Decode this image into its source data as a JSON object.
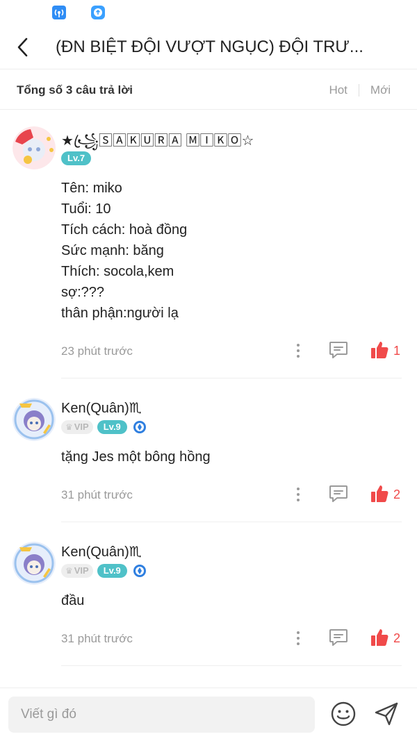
{
  "header": {
    "title": "(ĐN BIỆT ĐỘI VƯỢT NGỤC) ĐỘI TRƯ..."
  },
  "summary": {
    "count_label": "Tổng số 3 câu trả lời",
    "sort_hot": "Hot",
    "sort_new": "Mới"
  },
  "comments": [
    {
      "author": "★꧁ꦿ🅂🄰🄺🅄🅁🄰 🄼🄸🄺🄾☆",
      "level": "Lv.7",
      "lines": [
        "Tên: miko",
        "Tuổi: 10",
        "Tích cách: hoà đồng",
        "Sức mạnh: băng",
        "Thích: socola,kem",
        "sợ:???",
        "thân phận:người lạ"
      ],
      "time": "23 phút trước",
      "likes": "1"
    },
    {
      "author": "Ken(Quân)♏",
      "vip": "VIP",
      "level": "Lv.9",
      "lines": [
        "tặng Jes một bông hồng"
      ],
      "time": "31 phút trước",
      "likes": "2"
    },
    {
      "author": "Ken(Quân)♏",
      "vip": "VIP",
      "level": "Lv.9",
      "lines": [
        "đầu"
      ],
      "time": "31 phút trước",
      "likes": "2"
    }
  ],
  "composer": {
    "placeholder": "Viết gì đó"
  },
  "colors": {
    "like": "#f04a4a",
    "level_badge": "#4fc1c8",
    "muted_text": "#9a9a9a"
  }
}
